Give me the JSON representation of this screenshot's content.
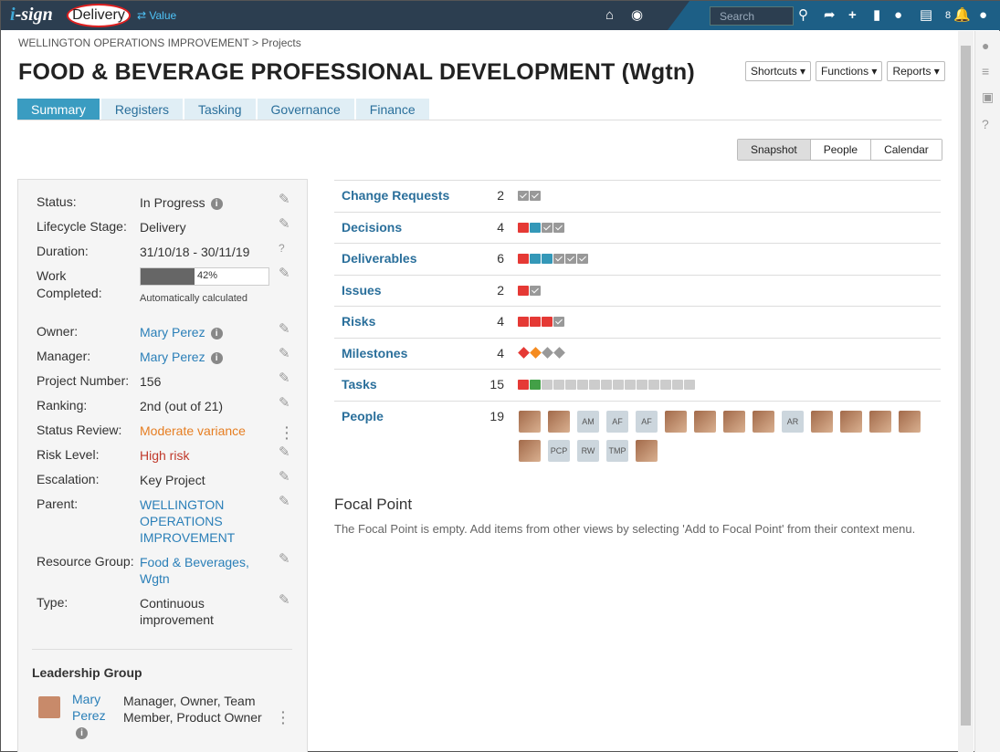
{
  "topbar": {
    "logo_i": "i",
    "logo_rest": "-sign",
    "mode": "Delivery",
    "switch_label": "⇄ Value",
    "search_placeholder": "Search",
    "notification_count": "8"
  },
  "breadcrumb": "WELLINGTON OPERATIONS IMPROVEMENT > Projects",
  "page_title": "FOOD & BEVERAGE PROFESSIONAL DEVELOPMENT (Wgtn)",
  "header_buttons": [
    "Shortcuts ▾",
    "Functions ▾",
    "Reports ▾"
  ],
  "tabs": [
    "Summary",
    "Registers",
    "Tasking",
    "Governance",
    "Finance"
  ],
  "views": [
    "Snapshot",
    "People",
    "Calendar"
  ],
  "properties": {
    "status": {
      "label": "Status:",
      "value": "In Progress"
    },
    "lifecycle": {
      "label": "Lifecycle Stage:",
      "value": "Delivery"
    },
    "duration": {
      "label": "Duration:",
      "value": "31/10/18 - 30/11/19"
    },
    "work": {
      "label": "Work Completed:",
      "percent": 42,
      "percent_text": "42%",
      "note": "Automatically calculated"
    },
    "owner": {
      "label": "Owner:",
      "value": "Mary Perez"
    },
    "manager": {
      "label": "Manager:",
      "value": "Mary Perez"
    },
    "project_number": {
      "label": "Project Number:",
      "value": "156"
    },
    "ranking": {
      "label": "Ranking:",
      "value": "2nd (out of 21)"
    },
    "status_review": {
      "label": "Status Review:",
      "value": "Moderate variance"
    },
    "risk_level": {
      "label": "Risk Level:",
      "value": "High risk"
    },
    "escalation": {
      "label": "Escalation:",
      "value": "Key Project"
    },
    "parent": {
      "label": "Parent:",
      "value": "WELLINGTON OPERATIONS IMPROVEMENT"
    },
    "resource_group": {
      "label": "Resource Group:",
      "value": "Food & Beverages, Wgtn"
    },
    "type": {
      "label": "Type:",
      "value": "Continuous improvement"
    }
  },
  "leadership": {
    "title": "Leadership Group",
    "name": "Mary Perez",
    "roles": "Manager, Owner, Team Member, Product Owner"
  },
  "registers": [
    {
      "name": "Change Requests",
      "count": "2",
      "chips": [
        "done",
        "done"
      ]
    },
    {
      "name": "Decisions",
      "count": "4",
      "chips": [
        "red",
        "blue",
        "done",
        "done"
      ]
    },
    {
      "name": "Deliverables",
      "count": "6",
      "chips": [
        "red",
        "blue",
        "blue",
        "done",
        "done",
        "done"
      ]
    },
    {
      "name": "Issues",
      "count": "2",
      "chips": [
        "red",
        "done"
      ]
    },
    {
      "name": "Risks",
      "count": "4",
      "chips": [
        "red",
        "red",
        "red",
        "done"
      ]
    },
    {
      "name": "Milestones",
      "count": "4",
      "diamonds": [
        "red",
        "orange",
        "grey",
        "grey"
      ]
    },
    {
      "name": "Tasks",
      "count": "15",
      "chips": [
        "red",
        "green",
        "grey",
        "grey",
        "grey",
        "grey",
        "grey",
        "grey",
        "grey",
        "grey",
        "grey",
        "grey",
        "grey",
        "grey",
        "grey"
      ]
    },
    {
      "name": "People",
      "count": "19",
      "people": [
        "",
        "",
        "AM",
        "AF",
        "AF",
        "",
        "",
        "",
        "",
        "AR",
        "",
        "",
        "",
        "",
        "",
        "PCP",
        "RW",
        "TMP",
        ""
      ]
    }
  ],
  "focal": {
    "title": "Focal Point",
    "text": "The Focal Point is empty. Add items from other views by selecting 'Add to Focal Point' from their context menu."
  },
  "colors": {
    "topbar": "#2c3e50",
    "accent": "#3a9cc1",
    "link": "#2a7fb8",
    "moderate": "#e67e22",
    "high_risk": "#c0392b"
  }
}
